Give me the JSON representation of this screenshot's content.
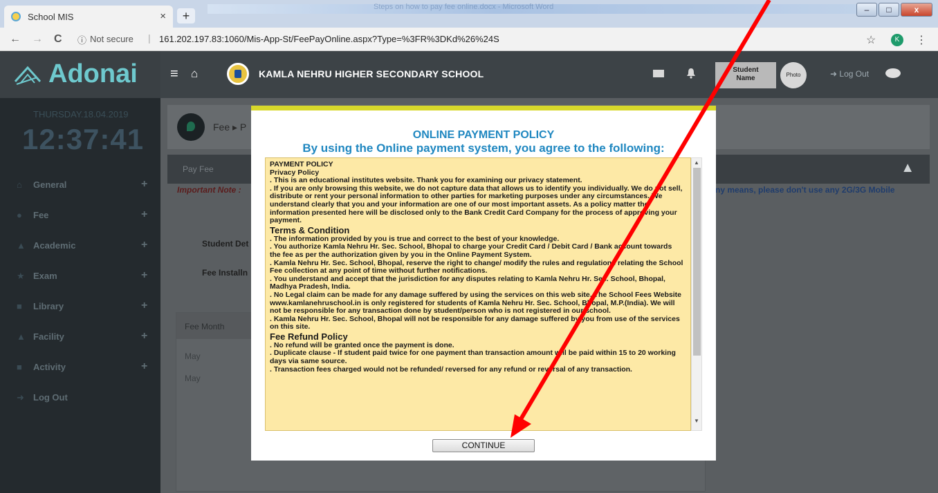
{
  "browser": {
    "tab_title": "School MIS",
    "tab_close": "×",
    "new_tab": "+",
    "titlebar_text": "Steps on how to pay fee online.docx - Microsoft Word",
    "win_min": "–",
    "win_max": "□",
    "win_close": "x",
    "back": "←",
    "forward": "→",
    "reload": "C",
    "info_icon": "ⓘ",
    "not_secure": "Not secure",
    "url_sep": "|",
    "url": "161.202.197.83:1060/Mis-App-St/FeePayOnline.aspx?Type=%3FR%3DKd%26%24S",
    "star": "☆",
    "profile_initial": "K",
    "menu": "⋮"
  },
  "header": {
    "brand": "Adonai",
    "menu_icon": "≡",
    "home_icon": "⌂",
    "school_name": "KAMLA NEHRU HIGHER SECONDARY SCHOOL",
    "bell_icon": "🔔",
    "student_name_l1": "Student",
    "student_name_l2": "Name",
    "photo": "Photo",
    "logout": "Log Out"
  },
  "sidebar": {
    "date": "THURSDAY.18.04.2019",
    "clock": "12:37:41",
    "items": [
      {
        "label": "General",
        "icon": "⌂",
        "plus": "+"
      },
      {
        "label": "Fee",
        "icon": "●",
        "plus": "+"
      },
      {
        "label": "Academic",
        "icon": "▲",
        "plus": "+"
      },
      {
        "label": "Exam",
        "icon": "★",
        "plus": "+"
      },
      {
        "label": "Library",
        "icon": "■",
        "plus": "+"
      },
      {
        "label": "Facility",
        "icon": "▲",
        "plus": "+"
      },
      {
        "label": "Activity",
        "icon": "■",
        "plus": "+"
      },
      {
        "label": "Log Out",
        "icon": "➜"
      }
    ]
  },
  "main": {
    "breadcrumb": "Fee ▸ P",
    "panel_title": "Pay Fee",
    "collapse_icon": "▲",
    "important_note": "Important Note :",
    "note_tail": "ny means, please don't use any 2G/3G Mobile",
    "student_details_label": "Student Det",
    "fee_installment_label": "Fee Installn",
    "fee_month_header": "Fee Month",
    "rows": [
      "May",
      "May"
    ]
  },
  "modal": {
    "title": "ONLINE PAYMENT POLICY",
    "subtitle": "By using the Online payment system, you agree to the following:",
    "continue": "CONTINUE",
    "scroll_up": "▲",
    "scroll_down": "▼",
    "policy": {
      "heading": "PAYMENT POLICY",
      "privacy_heading": "Privacy Policy",
      "privacy_1": ". This is an educational institutes website. Thank you for examining our privacy statement.",
      "privacy_2": ". If you are only browsing this website, we do not capture data that allows us to identify you individually. We do not sell, distribute or rent your personal information to other parties for marketing purposes under any circumstances. We understand clearly that you and your information are one of our most important assets. As a policy matter the information presented here will be disclosed only to the Bank Credit Card Company for the process of approving your payment.",
      "terms_heading": "Terms & Condition",
      "terms_1": ". The information provided by you is true and correct to the best of your knowledge.",
      "terms_2": ". You authorize Kamla Nehru Hr. Sec. School, Bhopal to charge your Credit Card / Debit Card / Bank account towards the fee as per the authorization given by you in the Online Payment System.",
      "terms_3": ". Kamla Nehru Hr. Sec. School, Bhopal, reserve the right to change/ modify the rules and regulations relating the School Fee collection at any point of time without further notifications.",
      "terms_4": ". You understand and accept that the jurisdiction for any disputes relating to Kamla Nehru Hr. Sec. School, Bhopal, Madhya Pradesh, India.",
      "terms_5": ". No Legal claim can be made for any damage suffered by using the services on this web site. The School Fees Website www.kamlanehruschool.in is only registered for students of Kamla Nehru Hr. Sec. School, Bhopal, M.P.(India). We will not be responsible for any transaction done by student/person who is not registered in our school.",
      "terms_6": ". Kamla Nehru Hr. Sec. School, Bhopal will not be responsible for any damage suffered by you from use of the services on this site.",
      "refund_heading": "Fee Refund Policy",
      "refund_1": ". No refund will be granted once the payment is done.",
      "refund_2": ". Duplicate clause - If student paid twice for one payment than transaction amount will be paid within 15 to 20 working days via same source.",
      "refund_3": ". Transaction fees charged would not be refunded/ reversed for any refund or reversal of any transaction."
    }
  },
  "colors": {
    "arrow": "#ff0000",
    "modal_accent": "#d8d82a",
    "title_blue": "#1f87c0",
    "policy_bg": "#fde9a6"
  }
}
